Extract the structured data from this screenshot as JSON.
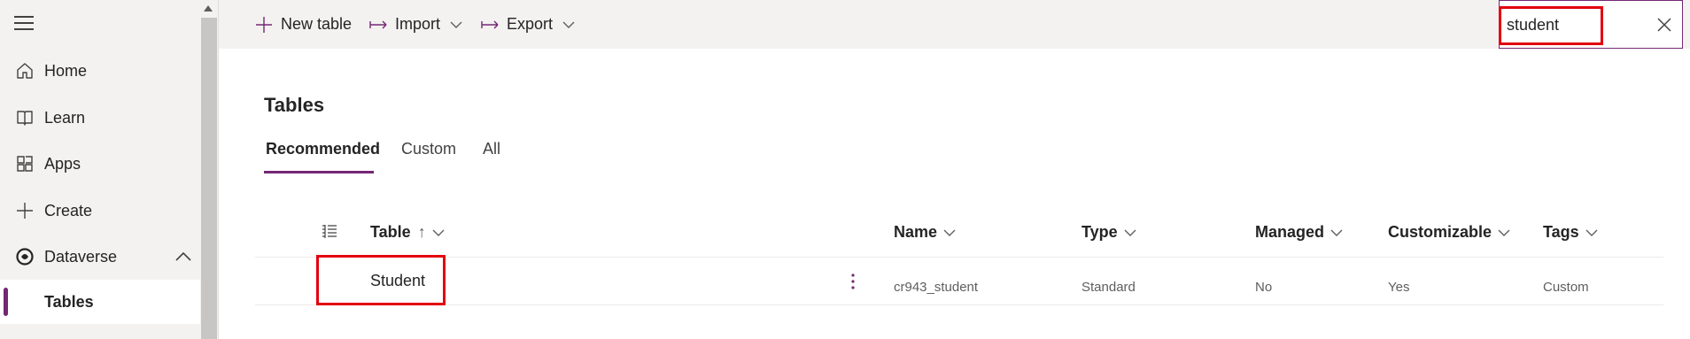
{
  "sidebar": {
    "items": [
      {
        "label": "Home",
        "icon": "home-icon"
      },
      {
        "label": "Learn",
        "icon": "book-icon"
      },
      {
        "label": "Apps",
        "icon": "apps-icon"
      },
      {
        "label": "Create",
        "icon": "plus-icon"
      },
      {
        "label": "Dataverse",
        "icon": "dataverse-icon"
      },
      {
        "label": "Tables",
        "icon": ""
      }
    ]
  },
  "toolbar": {
    "new_table": "New table",
    "import": "Import",
    "export": "Export"
  },
  "search": {
    "value": "student",
    "placeholder": "Search"
  },
  "main": {
    "title": "Tables",
    "tabs": [
      {
        "label": "Recommended",
        "active": true
      },
      {
        "label": "Custom",
        "active": false
      },
      {
        "label": "All",
        "active": false
      }
    ],
    "columns": [
      "Table",
      "Name",
      "Type",
      "Managed",
      "Customizable",
      "Tags"
    ],
    "sort_arrow": "↑",
    "rows": [
      {
        "table": "Student",
        "name": "cr943_student",
        "type": "Standard",
        "managed": "No",
        "customizable": "Yes",
        "tags": "Custom"
      }
    ]
  },
  "colors": {
    "accent": "#742774",
    "highlight": "#e3000f",
    "sidebar_bg": "#f3f2f1"
  }
}
